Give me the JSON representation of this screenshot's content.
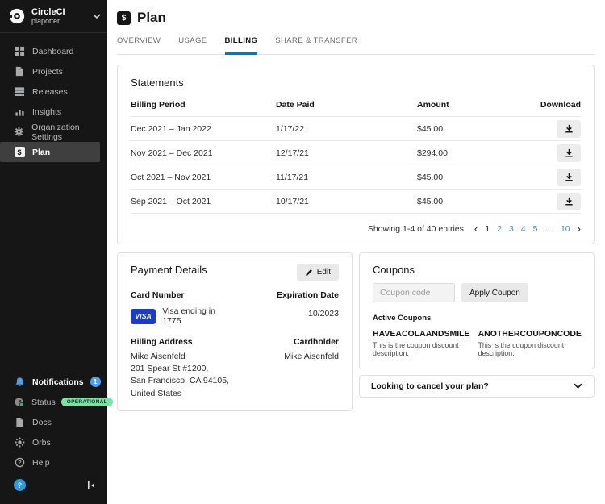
{
  "colors": {
    "accent_blue": "#0078CA",
    "link_blue": "#3B8BC9",
    "visa_blue": "#1A3CC8",
    "status_green": "#7EDFA6",
    "notification_blue": "#4AA0F5",
    "sidebar_bg": "#161616"
  },
  "sidebar": {
    "org": {
      "name": "CircleCI",
      "subtitle": "piapotter"
    },
    "nav": [
      {
        "label": "Dashboard",
        "icon": "dashboard-icon",
        "active": false
      },
      {
        "label": "Projects",
        "icon": "projects-icon",
        "active": false
      },
      {
        "label": "Releases",
        "icon": "releases-icon",
        "active": false
      },
      {
        "label": "Insights",
        "icon": "insights-icon",
        "active": false
      },
      {
        "label": "Organization Settings",
        "icon": "gear-icon",
        "active": false
      },
      {
        "label": "Plan",
        "icon": "dollar-icon",
        "active": true
      }
    ],
    "bottom": [
      {
        "label": "Notifications",
        "icon": "bell-icon",
        "badge": "1"
      },
      {
        "label": "Status",
        "icon": "status-gauge-icon",
        "badge": "OPERATIONAL"
      },
      {
        "label": "Docs",
        "icon": "document-icon"
      },
      {
        "label": "Orbs",
        "icon": "orb-icon"
      },
      {
        "label": "Help",
        "icon": "question-circle-icon"
      }
    ],
    "footer": {
      "help_widget": "?",
      "collapse_icon": "collapse-sidebar-icon"
    }
  },
  "header": {
    "title": "Plan",
    "icon": "dollar-square-icon"
  },
  "tabs": [
    {
      "label": "OVERVIEW",
      "active": false
    },
    {
      "label": "USAGE",
      "active": false
    },
    {
      "label": "BILLING",
      "active": true
    },
    {
      "label": "SHARE & TRANSFER",
      "active": false
    }
  ],
  "statements": {
    "title": "Statements",
    "columns": {
      "period": "Billing Period",
      "date_paid": "Date Paid",
      "amount": "Amount",
      "download": "Download"
    },
    "rows": [
      {
        "period": "Dec 2021 – Jan 2022",
        "date_paid": "1/17/22",
        "amount": "$45.00"
      },
      {
        "period": "Nov 2021 – Dec 2021",
        "date_paid": "12/17/21",
        "amount": "$294.00"
      },
      {
        "period": "Oct 2021 – Nov 2021",
        "date_paid": "11/17/21",
        "amount": "$45.00"
      },
      {
        "period": "Sep 2021 – Oct 2021",
        "date_paid": "10/17/21",
        "amount": "$45.00"
      }
    ],
    "pagination": {
      "summary": "Showing 1-4 of 40 entries",
      "prev": "‹",
      "next": "›",
      "pages": [
        "1",
        "2",
        "3",
        "4",
        "5",
        "…",
        "10"
      ],
      "current": "1"
    }
  },
  "payment": {
    "title": "Payment Details",
    "edit_label": "Edit",
    "card_number_label": "Card Number",
    "card_brand": "VISA",
    "card_text": "Visa ending in 1775",
    "expiration_label": "Expiration Date",
    "expiration_value": "10/2023",
    "billing_address_label": "Billing Address",
    "address_line1": "Mike Aisenfeld",
    "address_line2": "201 Spear St #1200,",
    "address_line3": "San Francisco, CA 94105, United States",
    "cardholder_label": "Cardholder",
    "cardholder_value": "Mike Aisenfeld"
  },
  "coupons": {
    "title": "Coupons",
    "input_placeholder": "Coupon code",
    "apply_label": "Apply Coupon",
    "active_label": "Active Coupons",
    "items": [
      {
        "code": "HAVEACOLAANDSMILE",
        "description": "This is the coupon discount description."
      },
      {
        "code": "ANOTHERCOUPONCODE",
        "description": "This is the coupon discount description."
      }
    ]
  },
  "cancel": {
    "label": "Looking to cancel your plan?"
  }
}
